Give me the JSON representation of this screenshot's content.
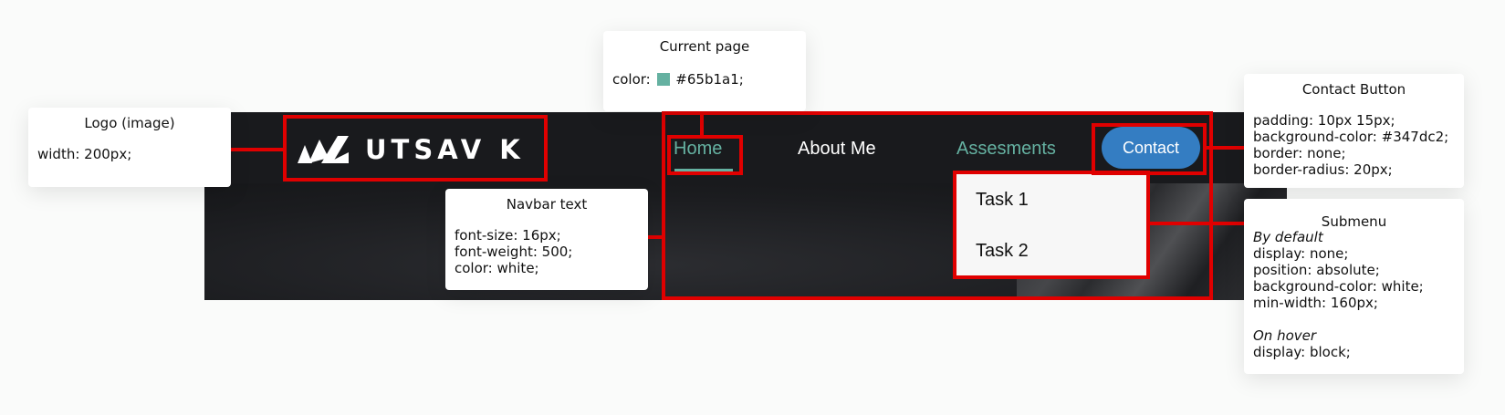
{
  "navbar": {
    "logo_text": "UTSAV K",
    "links": [
      "Home",
      "About Me",
      "Assesments"
    ],
    "contact_label": "Contact",
    "submenu": [
      "Task 1",
      "Task 2"
    ],
    "colors": {
      "current": "#65b1a1",
      "contact_bg": "#347dc2",
      "text": "#ffffff",
      "highlight": "#e00000"
    }
  },
  "annotations": {
    "logo": {
      "title": "Logo (image)",
      "lines": [
        "width: 200px;"
      ]
    },
    "current_page": {
      "title": "Current page",
      "prefix": "color:",
      "value": "#65b1a1;",
      "swatch": "#65b1a1"
    },
    "navbar_text": {
      "title": "Navbar text",
      "lines": [
        "font-size: 16px;",
        "font-weight: 500;",
        "color: white;"
      ]
    },
    "contact_button": {
      "title": "Contact Button",
      "lines": [
        "padding: 10px 15px;",
        "background-color: #347dc2;",
        "border: none;",
        "border-radius: 20px;"
      ]
    },
    "submenu": {
      "title": "Submenu",
      "default_heading": "By default",
      "default_lines": [
        "display: none;",
        "position: absolute;",
        "background-color: white;",
        "min-width: 160px;"
      ],
      "hover_heading": "On hover",
      "hover_lines": [
        "display: block;"
      ]
    }
  }
}
